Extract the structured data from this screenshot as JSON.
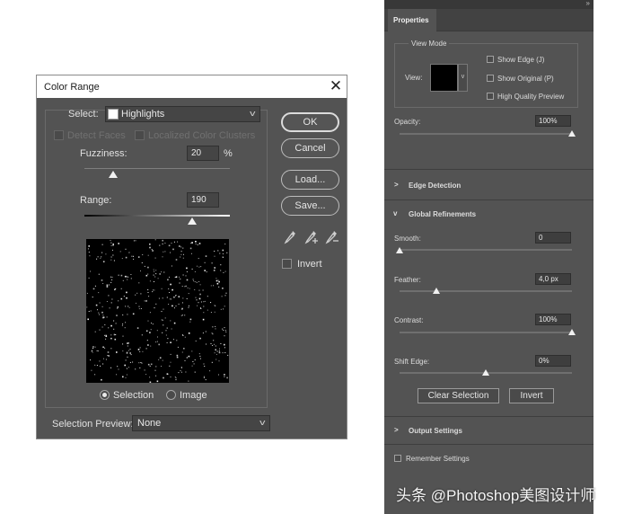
{
  "color_range": {
    "title": "Color Range",
    "close_glyph": "✕",
    "select_label": "Select:",
    "select_value": "Highlights",
    "detect_faces": "Detect Faces",
    "localized_color_clusters": "Localized Color Clusters",
    "fuzziness_label": "Fuzziness:",
    "fuzziness_value": "20",
    "fuzziness_unit": "%",
    "fuzziness_level": 0.2,
    "range_label": "Range:",
    "range_value": "190",
    "range_level": 0.74,
    "ok": "OK",
    "cancel": "Cancel",
    "load": "Load...",
    "save": "Save...",
    "invert": "Invert",
    "selection_radio": "Selection",
    "image_radio": "Image",
    "selection_preview_label": "Selection Preview:",
    "selection_preview_value": "None"
  },
  "properties": {
    "tab": "Properties",
    "view_mode": "View Mode",
    "view_label": "View:",
    "show_edge": "Show Edge (J)",
    "show_original": "Show Original (P)",
    "high_quality_preview": "High Quality Preview",
    "opacity_label": "Opacity:",
    "opacity_value": "100%",
    "edge_detection": "Edge Detection",
    "global_refinements": "Global Refinements",
    "smooth_label": "Smooth:",
    "smooth_value": "0",
    "feather_label": "Feather:",
    "feather_value": "4,0 px",
    "contrast_label": "Contrast:",
    "contrast_value": "100%",
    "shift_edge_label": "Shift Edge:",
    "shift_edge_value": "0%",
    "clear_selection": "Clear Selection",
    "invert": "Invert",
    "output_settings": "Output Settings",
    "remember_settings": "Remember Settings"
  },
  "watermark": "头条 @Photoshop美图设计师",
  "icons": [
    "close-icon",
    "chevron-down-icon",
    "eyedropper-icon",
    "eyedropper-plus-icon",
    "eyedropper-minus-icon",
    "chevron-right-icon",
    "collapse-arrows-icon"
  ]
}
